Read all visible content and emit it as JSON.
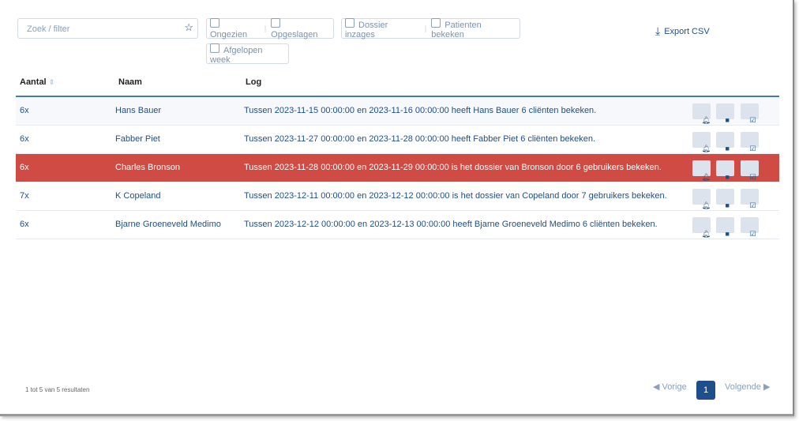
{
  "search": {
    "placeholder": "Zoek / filter"
  },
  "filters": {
    "ongezien": "Ongezien",
    "opgeslagen": "Opgeslagen",
    "dossier": "Dossier inzages",
    "patienten": "Patienten bekeken",
    "week": "Afgelopen week"
  },
  "export_label": "Export CSV",
  "columns": {
    "aantal": "Aantal",
    "naam": "Naam",
    "log": "Log"
  },
  "rows": [
    {
      "aantal": "6x",
      "naam": "Hans Bauer",
      "log": "Tussen 2023-11-15 00:00:00 en 2023-11-16 00:00:00 heeft Hans Bauer 6 cliënten bekeken."
    },
    {
      "aantal": "6x",
      "naam": "Fabber Piet",
      "log": "Tussen 2023-11-27 00:00:00 en 2023-11-28 00:00:00 heeft Fabber Piet 6 cliënten bekeken."
    },
    {
      "aantal": "6x",
      "naam": "Charles Bronson",
      "log": "Tussen 2023-11-28 00:00:00 en 2023-11-29 00:00:00 is het dossier van Bronson door 6 gebruikers bekeken."
    },
    {
      "aantal": "7x",
      "naam": "K Copeland",
      "log": "Tussen 2023-12-11 00:00:00 en 2023-12-12 00:00:00 is het dossier van Copeland door 7 gebruikers bekeken."
    },
    {
      "aantal": "6x",
      "naam": "Bjarne Groeneveld Medimo",
      "log": "Tussen 2023-12-12 00:00:00 en 2023-12-13 00:00:00 heeft Bjarne Groeneveld Medimo 6 cliënten bekeken."
    }
  ],
  "footer": {
    "results": "1 tot 5 van 5 resultaten",
    "prev": "Vorige",
    "page": "1",
    "next": "Volgende"
  },
  "colors": {
    "highlight": "#d04b43",
    "accent": "#1e4f8a"
  }
}
